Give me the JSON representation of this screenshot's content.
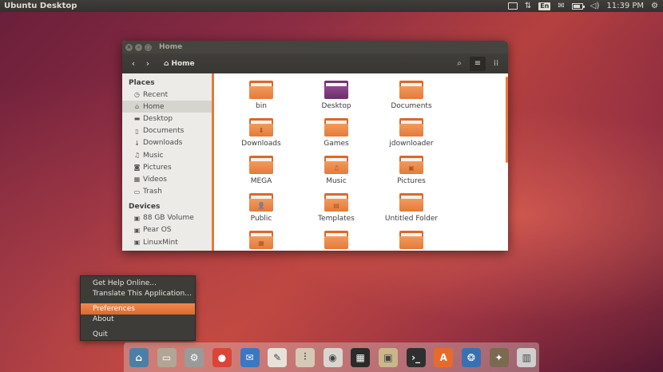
{
  "panel": {
    "app_title": "Ubuntu Desktop",
    "lang": "En",
    "clock": "11:39 PM",
    "icons": [
      "keyboard-icon",
      "network-icon",
      "language-icon",
      "mail-icon",
      "battery-icon",
      "volume-icon",
      "gear-icon"
    ]
  },
  "window": {
    "title": "Home",
    "breadcrumb": "Home"
  },
  "sidebar": {
    "places_heading": "Places",
    "places": [
      {
        "label": "Recent",
        "icon": "recent-icon",
        "glyph": "◷"
      },
      {
        "label": "Home",
        "icon": "home-icon",
        "glyph": "⌂"
      },
      {
        "label": "Desktop",
        "icon": "folder-icon",
        "glyph": "▬"
      },
      {
        "label": "Documents",
        "icon": "document-icon",
        "glyph": "▯"
      },
      {
        "label": "Downloads",
        "icon": "download-icon",
        "glyph": "↓"
      },
      {
        "label": "Music",
        "icon": "music-icon",
        "glyph": "♫"
      },
      {
        "label": "Pictures",
        "icon": "camera-icon",
        "glyph": "◙"
      },
      {
        "label": "Videos",
        "icon": "film-icon",
        "glyph": "▦"
      },
      {
        "label": "Trash",
        "icon": "trash-icon",
        "glyph": "▭"
      }
    ],
    "devices_heading": "Devices",
    "devices": [
      {
        "label": "88 GB Volume",
        "icon": "drive-icon",
        "glyph": "▣"
      },
      {
        "label": "Pear OS",
        "icon": "drive-icon",
        "glyph": "▣"
      },
      {
        "label": "LinuxMint",
        "icon": "drive-icon",
        "glyph": "▣"
      }
    ]
  },
  "files": [
    {
      "label": "bin",
      "icon": "folder-icon",
      "emblem": ""
    },
    {
      "label": "Desktop",
      "icon": "desktop-folder-icon",
      "emblem": ""
    },
    {
      "label": "Documents",
      "icon": "documents-folder-icon",
      "emblem": ""
    },
    {
      "label": "Downloads",
      "icon": "downloads-folder-icon",
      "emblem": "⬇"
    },
    {
      "label": "Games",
      "icon": "folder-icon",
      "emblem": ""
    },
    {
      "label": "jdownloader",
      "icon": "folder-icon",
      "emblem": ""
    },
    {
      "label": "MEGA",
      "icon": "folder-icon",
      "emblem": ""
    },
    {
      "label": "Music",
      "icon": "music-folder-icon",
      "emblem": "♫"
    },
    {
      "label": "Pictures",
      "icon": "pictures-folder-icon",
      "emblem": "▣"
    },
    {
      "label": "Public",
      "icon": "public-folder-icon",
      "emblem": "👤"
    },
    {
      "label": "Templates",
      "icon": "templates-folder-icon",
      "emblem": "▤"
    },
    {
      "label": "Untitled Folder",
      "icon": "folder-icon",
      "emblem": ""
    },
    {
      "label": "",
      "icon": "videos-folder-icon",
      "emblem": "▦"
    },
    {
      "label": "",
      "icon": "folder-icon",
      "emblem": ""
    },
    {
      "label": "",
      "icon": "folder-icon",
      "emblem": ""
    }
  ],
  "context_menu": {
    "items": [
      {
        "label": "Get Help Online...",
        "highlight": false
      },
      {
        "label": "Translate This Application...",
        "highlight": false
      },
      {
        "label": "Preferences",
        "highlight": true
      },
      {
        "label": "About",
        "highlight": false
      },
      {
        "label": "Quit",
        "highlight": false
      }
    ]
  },
  "dock": {
    "items": [
      {
        "name": "dash-icon",
        "color": "#4c7fa6",
        "glyph": "⌂"
      },
      {
        "name": "files-icon",
        "color": "#b3a596",
        "glyph": "▭"
      },
      {
        "name": "system-settings-icon",
        "color": "#9a9a9a",
        "glyph": "⚙"
      },
      {
        "name": "chrome-icon",
        "color": "#db4437",
        "glyph": "●"
      },
      {
        "name": "thunderbird-icon",
        "color": "#3a78c0",
        "glyph": "✉"
      },
      {
        "name": "text-editor-icon",
        "color": "#e6e2da",
        "glyph": "✎"
      },
      {
        "name": "mixer-icon",
        "color": "#d4c8b6",
        "glyph": "⫶"
      },
      {
        "name": "media-player-icon",
        "color": "#d8d6cf",
        "glyph": "◉"
      },
      {
        "name": "video-editor-icon",
        "color": "#2b2b2b",
        "glyph": "▦"
      },
      {
        "name": "image-viewer-icon",
        "color": "#c9b78a",
        "glyph": "▣"
      },
      {
        "name": "terminal-icon",
        "color": "#2f2f2f",
        "glyph": "›_"
      },
      {
        "name": "software-center-icon",
        "color": "#e86a2a",
        "glyph": "A"
      },
      {
        "name": "swirl-icon",
        "color": "#3b6fb3",
        "glyph": "❂"
      },
      {
        "name": "gimp-icon",
        "color": "#7a6a50",
        "glyph": "✦"
      },
      {
        "name": "scanner-icon",
        "color": "#cfcfcf",
        "glyph": "▥"
      }
    ]
  }
}
